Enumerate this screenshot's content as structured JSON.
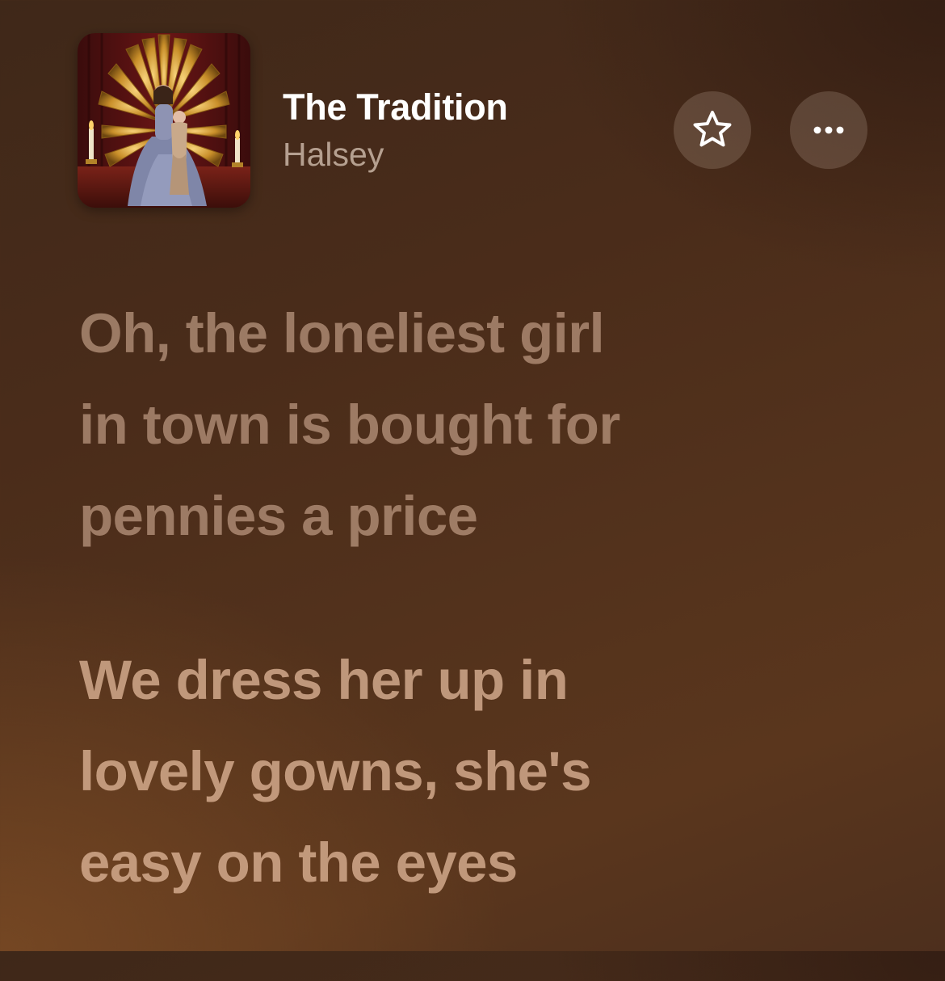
{
  "now_playing": {
    "title": "The Tradition",
    "artist": "Halsey",
    "album_art_icon": "album-cover-art"
  },
  "actions": {
    "favorite_icon": "star-outline-icon",
    "more_icon": "ellipsis-icon"
  },
  "lyrics": [
    {
      "lines": [
        "Oh, the loneliest girl",
        "in town is bought for",
        "pennies a price"
      ]
    },
    {
      "lines": [
        "We dress her up in",
        "lovely gowns, she's",
        "easy on the eyes"
      ]
    }
  ],
  "colors": {
    "title": "#ffffff",
    "artist": "#c9b3a3",
    "lyric_text": "#d7b49b",
    "button_bg": "#6b4c3a"
  }
}
